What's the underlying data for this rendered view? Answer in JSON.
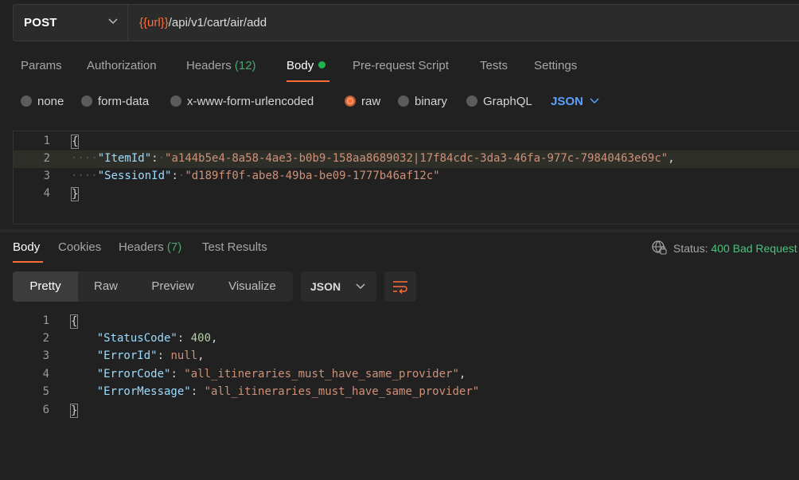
{
  "request": {
    "method": "POST",
    "url_variable": "{{url}}",
    "url_path": "/api/v1/cart/air/add"
  },
  "tabs": [
    {
      "label": "Params"
    },
    {
      "label": "Authorization"
    },
    {
      "label": "Headers",
      "count": "(12)"
    },
    {
      "label": "Body"
    },
    {
      "label": "Pre-request Script"
    },
    {
      "label": "Tests"
    },
    {
      "label": "Settings"
    }
  ],
  "body_types": [
    "none",
    "form-data",
    "x-www-form-urlencoded",
    "raw",
    "binary",
    "GraphQL"
  ],
  "body_format": "JSON",
  "request_body": {
    "line_numbers": [
      "1",
      "2",
      "3",
      "4"
    ],
    "open": "{",
    "close": "}",
    "item_key": "\"ItemId\"",
    "item_value": "\"a144b5e4-8a58-4ae3-b0b9-158aa8689032|17f84cdc-3da3-46fa-977c-79840463e69c\"",
    "session_key": "\"SessionId\"",
    "session_value": "\"d189ff0f-abe8-49ba-be09-1777b46af12c\""
  },
  "response_tabs": [
    {
      "label": "Body"
    },
    {
      "label": "Cookies"
    },
    {
      "label": "Headers",
      "count": "(7)"
    },
    {
      "label": "Test Results"
    }
  ],
  "status": {
    "label": "Status:",
    "value": "400 Bad Request",
    "color": "#49c27a"
  },
  "view_modes": [
    "Pretty",
    "Raw",
    "Preview",
    "Visualize"
  ],
  "response_format": "JSON",
  "response_body": {
    "line_numbers": [
      "1",
      "2",
      "3",
      "4",
      "5",
      "6"
    ],
    "open": "{",
    "close": "}",
    "status_key": "\"StatusCode\"",
    "status_value": "400",
    "error_id_key": "\"ErrorId\"",
    "error_id_value": "null",
    "error_code_key": "\"ErrorCode\"",
    "error_code_value": "\"all_itineraries_must_have_same_provider\"",
    "error_message_key": "\"ErrorMessage\"",
    "error_message_value": "\"all_itineraries_must_have_same_provider\""
  },
  "colors": {
    "accent": "#ff6c37",
    "link": "#5aa0ff",
    "success": "#1fb34d"
  }
}
